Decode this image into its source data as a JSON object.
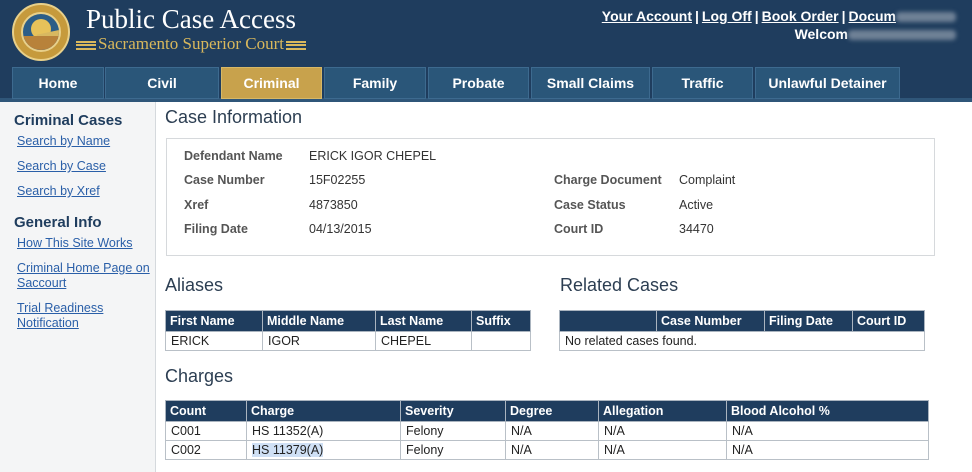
{
  "header": {
    "title": "Public Case Access",
    "subtitle": "Sacramento Superior Court",
    "links": {
      "account": "Your Account",
      "logoff": "Log Off",
      "book_order": "Book Order",
      "documents": "Docum"
    },
    "welcome": "Welcom"
  },
  "nav": {
    "tabs": [
      "Home",
      "Civil",
      "Criminal",
      "Family",
      "Probate",
      "Small Claims",
      "Traffic",
      "Unlawful Detainer"
    ],
    "active": "Criminal"
  },
  "sidebar": {
    "criminal_heading": "Criminal Cases",
    "criminal_links": [
      "Search by Name",
      "Search by Case",
      "Search by Xref"
    ],
    "general_heading": "General Info",
    "general_links": [
      "How This Site Works",
      "Criminal Home Page on Saccourt",
      "Trial Readiness Notification"
    ]
  },
  "case_info": {
    "title": "Case Information",
    "defendant_label": "Defendant Name",
    "defendant": "ERICK IGOR CHEPEL",
    "case_number_label": "Case Number",
    "case_number": "15F02255",
    "xref_label": "Xref",
    "xref": "4873850",
    "filing_date_label": "Filing Date",
    "filing_date": "04/13/2015",
    "charge_doc_label": "Charge Document",
    "charge_doc": "Complaint",
    "status_label": "Case Status",
    "status": "Active",
    "court_id_label": "Court ID",
    "court_id": "34470"
  },
  "aliases": {
    "title": "Aliases",
    "headers": [
      "First Name",
      "Middle Name",
      "Last Name",
      "Suffix"
    ],
    "rows": [
      [
        "ERICK",
        "IGOR",
        "CHEPEL",
        ""
      ]
    ]
  },
  "related_cases": {
    "title": "Related Cases",
    "headers": [
      "",
      "Case Number",
      "Filing Date",
      "Court ID"
    ],
    "empty_message": "No related cases found."
  },
  "charges": {
    "title": "Charges",
    "headers": [
      "Count",
      "Charge",
      "Severity",
      "Degree",
      "Allegation",
      "Blood Alcohol %"
    ],
    "rows": [
      [
        "C001",
        "HS 11352(A)",
        "Felony",
        "N/A",
        "N/A",
        "N/A"
      ],
      [
        "C002",
        "HS 11379(A)",
        "Felony",
        "N/A",
        "N/A",
        "N/A"
      ]
    ]
  },
  "colors": {
    "header_bg": "#1f3d5e",
    "active_tab": "#c8a24c",
    "tab_bg": "#2a5679",
    "link": "#2a5fa8"
  },
  "icons": {
    "logo": "court-seal-logo"
  }
}
